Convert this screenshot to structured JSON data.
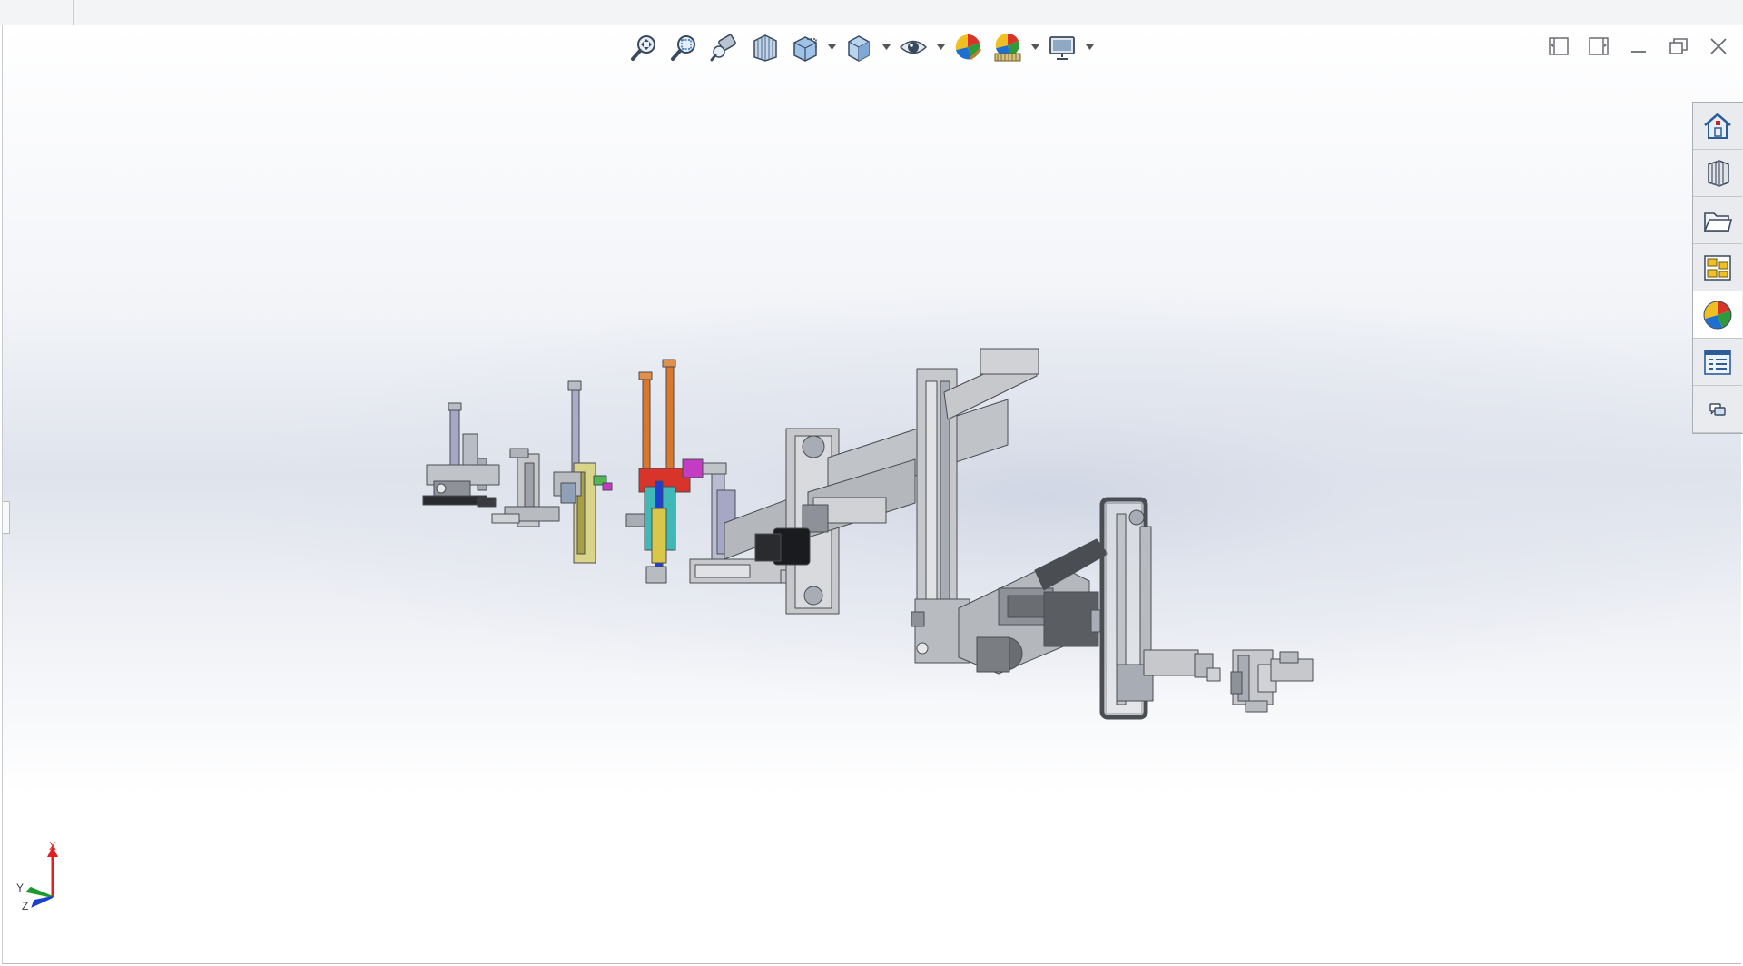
{
  "triad": {
    "x_label": "X",
    "y_label": "Y",
    "z_label": "Z"
  },
  "heads_up_toolbar": [
    {
      "name": "zoom-to-fit-icon",
      "has_dropdown": false
    },
    {
      "name": "zoom-to-area-icon",
      "has_dropdown": false
    },
    {
      "name": "previous-view-icon",
      "has_dropdown": false
    },
    {
      "name": "section-view-icon",
      "has_dropdown": false
    },
    {
      "name": "view-orientation-icon",
      "has_dropdown": true
    },
    {
      "name": "display-style-icon",
      "has_dropdown": true
    },
    {
      "name": "hide-show-items-icon",
      "has_dropdown": true
    },
    {
      "name": "edit-appearance-icon",
      "has_dropdown": false
    },
    {
      "name": "apply-scene-icon",
      "has_dropdown": true
    },
    {
      "name": "view-settings-icon",
      "has_dropdown": true
    }
  ],
  "window_controls": [
    "tile-left-icon",
    "tile-right-icon",
    "minimize-icon",
    "restore-icon",
    "close-icon"
  ],
  "task_pane": [
    {
      "name": "solidworks-resources-icon",
      "active": false
    },
    {
      "name": "design-library-icon",
      "active": false
    },
    {
      "name": "file-explorer-icon",
      "active": false
    },
    {
      "name": "view-palette-icon",
      "active": false
    },
    {
      "name": "appearances-scenes-icon",
      "active": true
    },
    {
      "name": "custom-properties-icon",
      "active": false
    },
    {
      "name": "forum-icon",
      "active": false
    }
  ],
  "colors": {
    "accent_blue": "#1f6fd1",
    "model_gray": "#a8acb4",
    "model_dark": "#4a4d52",
    "part_orange": "#d9782a",
    "part_purple": "#8f86c4",
    "part_magenta": "#c43bc4",
    "part_yellow": "#d9d48a",
    "part_teal": "#3fb8b8",
    "part_red": "#d9342a",
    "axis_x": "#e02020",
    "axis_y": "#1a9a2a",
    "axis_z": "#1c3fd0"
  }
}
